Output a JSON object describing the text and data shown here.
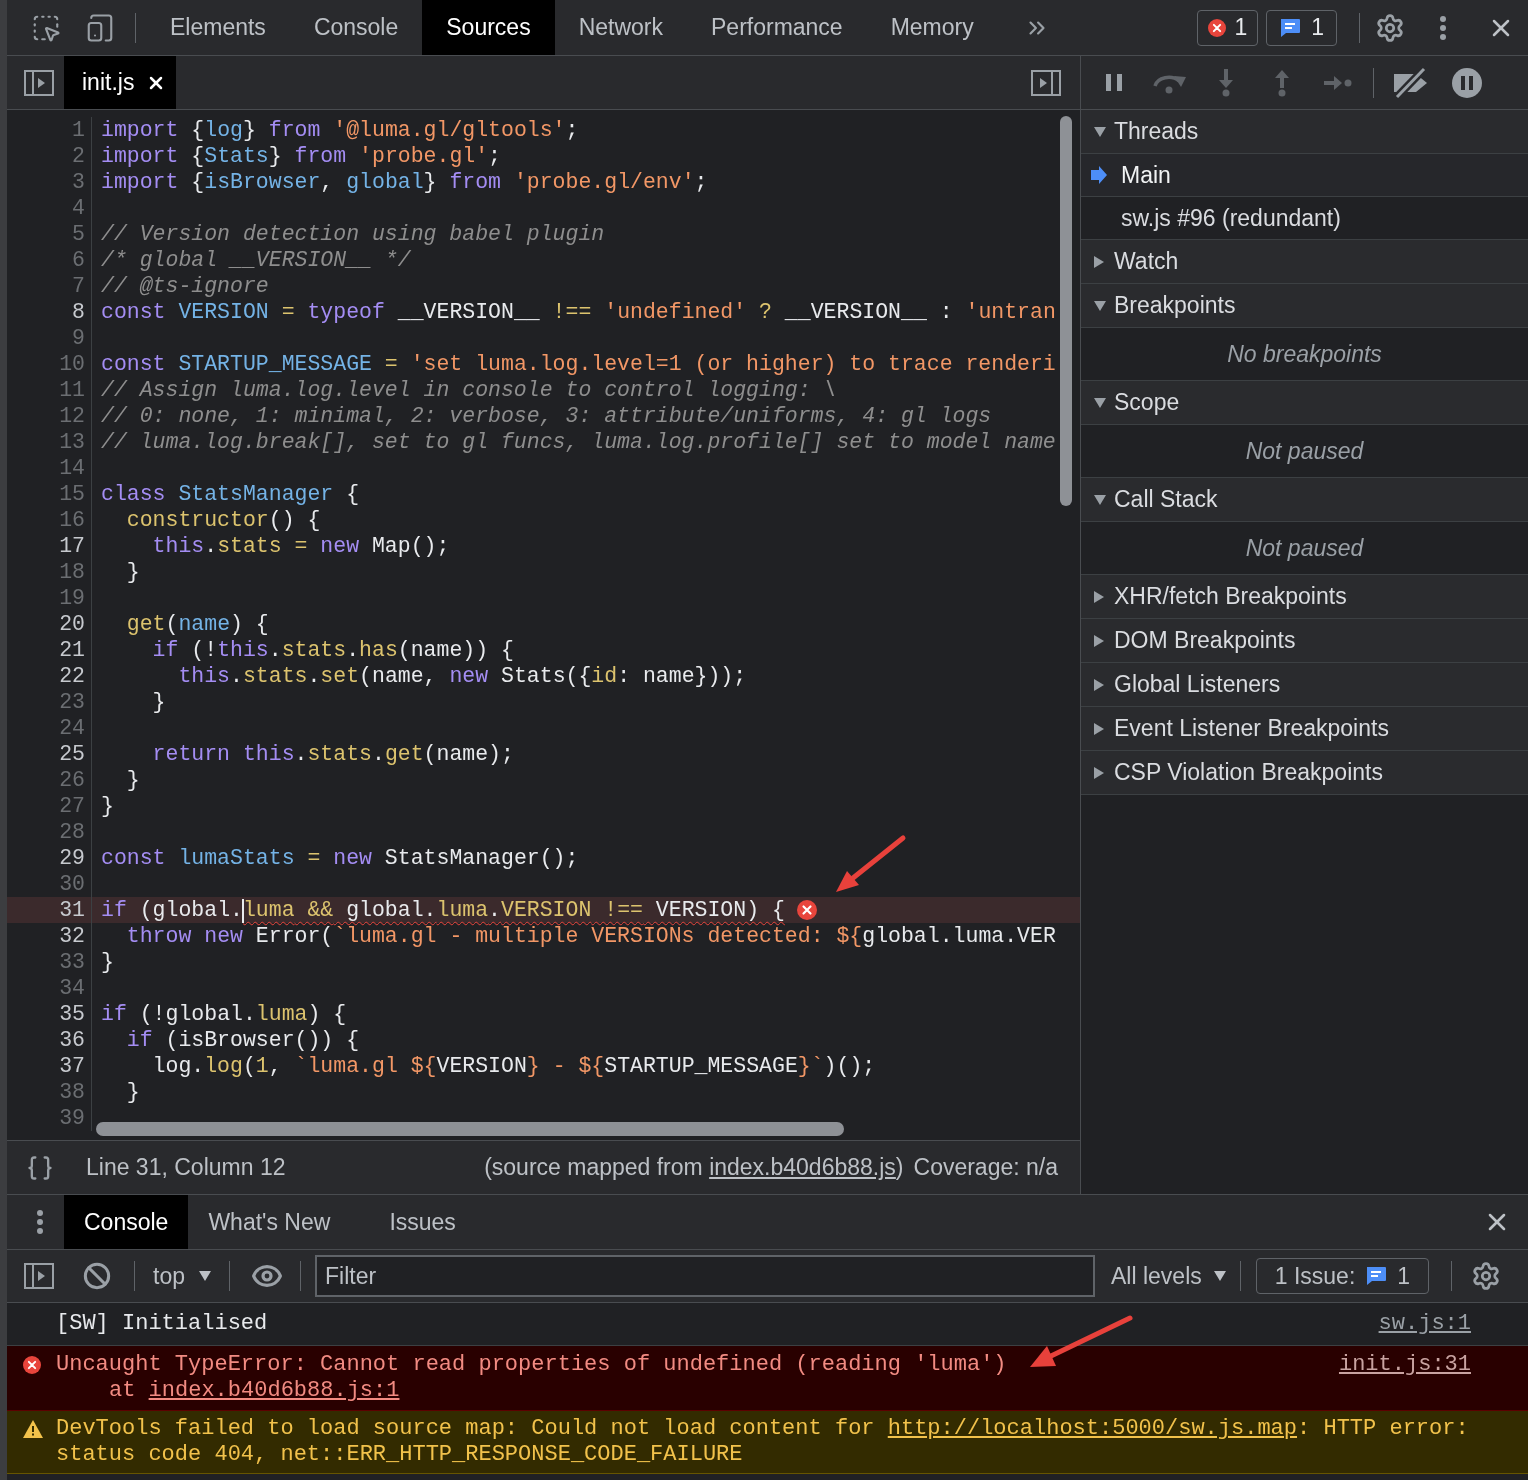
{
  "devtools_tabs": [
    {
      "label": "Elements",
      "selected": false
    },
    {
      "label": "Console",
      "selected": false
    },
    {
      "label": "Sources",
      "selected": true
    },
    {
      "label": "Network",
      "selected": false
    },
    {
      "label": "Performance",
      "selected": false
    },
    {
      "label": "Memory",
      "selected": false
    }
  ],
  "counters": {
    "errors": "1",
    "messages": "1"
  },
  "editor": {
    "open_files": [
      {
        "name": "init.js",
        "selected": true
      }
    ],
    "lines": [
      {
        "number": "1",
        "mapped": false,
        "error": false,
        "tokens": [
          {
            "kind": "keyword",
            "text": "import"
          },
          {
            "kind": "plain",
            "text": " {"
          },
          {
            "kind": "def",
            "text": "log"
          },
          {
            "kind": "plain",
            "text": "} "
          },
          {
            "kind": "keyword",
            "text": "from"
          },
          {
            "kind": "string",
            "text": " '@luma.gl/gltools'"
          },
          {
            "kind": "plain",
            "text": ";"
          }
        ]
      },
      {
        "number": "2",
        "mapped": false,
        "error": false,
        "tokens": [
          {
            "kind": "keyword",
            "text": "import"
          },
          {
            "kind": "plain",
            "text": " {"
          },
          {
            "kind": "def",
            "text": "Stats"
          },
          {
            "kind": "plain",
            "text": "} "
          },
          {
            "kind": "keyword",
            "text": "from"
          },
          {
            "kind": "string",
            "text": " 'probe.gl'"
          },
          {
            "kind": "plain",
            "text": ";"
          }
        ]
      },
      {
        "number": "3",
        "mapped": false,
        "error": false,
        "tokens": [
          {
            "kind": "keyword",
            "text": "import"
          },
          {
            "kind": "plain",
            "text": " {"
          },
          {
            "kind": "def",
            "text": "isBrowser"
          },
          {
            "kind": "plain",
            "text": ", "
          },
          {
            "kind": "def",
            "text": "global"
          },
          {
            "kind": "plain",
            "text": "} "
          },
          {
            "kind": "keyword",
            "text": "from"
          },
          {
            "kind": "string",
            "text": " 'probe.gl/env'"
          },
          {
            "kind": "plain",
            "text": ";"
          }
        ]
      },
      {
        "number": "4",
        "mapped": false,
        "error": false
      },
      {
        "number": "5",
        "mapped": false,
        "error": false,
        "tokens": [
          {
            "kind": "comment",
            "text": "// Version detection using babel plugin"
          }
        ]
      },
      {
        "number": "6",
        "mapped": false,
        "error": false,
        "tokens": [
          {
            "kind": "comment",
            "text": "/* global __VERSION__ */"
          }
        ]
      },
      {
        "number": "7",
        "mapped": false,
        "error": false,
        "tokens": [
          {
            "kind": "comment",
            "text": "// @ts-ignore"
          }
        ]
      },
      {
        "number": "8",
        "mapped": true,
        "error": false,
        "tokens": [
          {
            "kind": "keyword",
            "text": "const"
          },
          {
            "kind": "def",
            "text": " VERSION"
          },
          {
            "kind": "operator",
            "text": " ="
          },
          {
            "kind": "keyword",
            "text": " typeof"
          },
          {
            "kind": "plain",
            "text": " __VERSION__ "
          },
          {
            "kind": "operator",
            "text": "!=="
          },
          {
            "kind": "string",
            "text": " 'undefined'"
          },
          {
            "kind": "operator",
            "text": " ?"
          },
          {
            "kind": "plain",
            "text": " __VERSION__ : "
          },
          {
            "kind": "string",
            "text": "'untran"
          }
        ]
      },
      {
        "number": "9",
        "mapped": false,
        "error": false
      },
      {
        "number": "10",
        "mapped": false,
        "error": false,
        "tokens": [
          {
            "kind": "keyword",
            "text": "const"
          },
          {
            "kind": "def",
            "text": " STARTUP_MESSAGE"
          },
          {
            "kind": "operator",
            "text": " ="
          },
          {
            "kind": "string",
            "text": " 'set luma.log.level=1 (or higher) to trace renderi"
          }
        ]
      },
      {
        "number": "11",
        "mapped": false,
        "error": false,
        "tokens": [
          {
            "kind": "comment",
            "text": "// Assign luma.log.level in console to control logging: \\"
          }
        ]
      },
      {
        "number": "12",
        "mapped": false,
        "error": false,
        "tokens": [
          {
            "kind": "comment",
            "text": "// 0: none, 1: minimal, 2: verbose, 3: attribute/uniforms, 4: gl logs"
          }
        ]
      },
      {
        "number": "13",
        "mapped": false,
        "error": false,
        "tokens": [
          {
            "kind": "comment",
            "text": "// luma.log.break[], set to gl funcs, luma.log.profile[] set to model name"
          }
        ]
      },
      {
        "number": "14",
        "mapped": false,
        "error": false
      },
      {
        "number": "15",
        "mapped": false,
        "error": false,
        "tokens": [
          {
            "kind": "keyword",
            "text": "class"
          },
          {
            "kind": "def",
            "text": " StatsManager"
          },
          {
            "kind": "plain",
            "text": " {"
          }
        ]
      },
      {
        "number": "16",
        "mapped": false,
        "error": false,
        "tokens": [
          {
            "kind": "property",
            "text": "  constructor"
          },
          {
            "kind": "plain",
            "text": "() {"
          }
        ]
      },
      {
        "number": "17",
        "mapped": true,
        "error": false,
        "tokens": [
          {
            "kind": "keyword",
            "text": "    this"
          },
          {
            "kind": "plain",
            "text": "."
          },
          {
            "kind": "property",
            "text": "stats"
          },
          {
            "kind": "operator",
            "text": " ="
          },
          {
            "kind": "keyword",
            "text": " new"
          },
          {
            "kind": "plain",
            "text": " Map();"
          }
        ]
      },
      {
        "number": "18",
        "mapped": false,
        "error": false,
        "tokens": [
          {
            "kind": "plain",
            "text": "  }"
          }
        ]
      },
      {
        "number": "19",
        "mapped": false,
        "error": false
      },
      {
        "number": "20",
        "mapped": true,
        "error": false,
        "tokens": [
          {
            "kind": "property",
            "text": "  get"
          },
          {
            "kind": "plain",
            "text": "("
          },
          {
            "kind": "def",
            "text": "name"
          },
          {
            "kind": "plain",
            "text": ") {"
          }
        ]
      },
      {
        "number": "21",
        "mapped": true,
        "error": false,
        "tokens": [
          {
            "kind": "keyword",
            "text": "    if"
          },
          {
            "kind": "plain",
            "text": " (!"
          },
          {
            "kind": "keyword",
            "text": "this"
          },
          {
            "kind": "plain",
            "text": "."
          },
          {
            "kind": "property",
            "text": "stats"
          },
          {
            "kind": "plain",
            "text": "."
          },
          {
            "kind": "property",
            "text": "has"
          },
          {
            "kind": "plain",
            "text": "(name)) {"
          }
        ]
      },
      {
        "number": "22",
        "mapped": true,
        "error": false,
        "tokens": [
          {
            "kind": "keyword",
            "text": "      this"
          },
          {
            "kind": "plain",
            "text": "."
          },
          {
            "kind": "property",
            "text": "stats"
          },
          {
            "kind": "plain",
            "text": "."
          },
          {
            "kind": "property",
            "text": "set"
          },
          {
            "kind": "plain",
            "text": "(name, "
          },
          {
            "kind": "keyword",
            "text": "new"
          },
          {
            "kind": "plain",
            "text": " Stats({"
          },
          {
            "kind": "property",
            "text": "id"
          },
          {
            "kind": "plain",
            "text": ": name}));"
          }
        ]
      },
      {
        "number": "23",
        "mapped": false,
        "error": false,
        "tokens": [
          {
            "kind": "plain",
            "text": "    }"
          }
        ]
      },
      {
        "number": "24",
        "mapped": false,
        "error": false
      },
      {
        "number": "25",
        "mapped": true,
        "error": false,
        "tokens": [
          {
            "kind": "keyword",
            "text": "    return"
          },
          {
            "kind": "keyword",
            "text": " this"
          },
          {
            "kind": "plain",
            "text": "."
          },
          {
            "kind": "property",
            "text": "stats"
          },
          {
            "kind": "plain",
            "text": "."
          },
          {
            "kind": "property",
            "text": "get"
          },
          {
            "kind": "plain",
            "text": "(name);"
          }
        ]
      },
      {
        "number": "26",
        "mapped": false,
        "error": false,
        "tokens": [
          {
            "kind": "plain",
            "text": "  }"
          }
        ]
      },
      {
        "number": "27",
        "mapped": false,
        "error": false,
        "tokens": [
          {
            "kind": "plain",
            "text": "}"
          }
        ]
      },
      {
        "number": "28",
        "mapped": false,
        "error": false
      },
      {
        "number": "29",
        "mapped": true,
        "error": false,
        "tokens": [
          {
            "kind": "keyword",
            "text": "const"
          },
          {
            "kind": "def",
            "text": " lumaStats"
          },
          {
            "kind": "operator",
            "text": " ="
          },
          {
            "kind": "keyword",
            "text": " new"
          },
          {
            "kind": "plain",
            "text": " StatsManager();"
          }
        ]
      },
      {
        "number": "30",
        "mapped": false,
        "error": false
      },
      {
        "number": "31",
        "mapped": true,
        "error": true,
        "tokens": [
          {
            "kind": "keyword",
            "text": "if",
            "squiggle": false,
            "caret": false
          },
          {
            "kind": "plain",
            "text": " (global.",
            "squiggle": false,
            "caret": false
          },
          {
            "kind": "property",
            "text": "luma",
            "squiggle": true,
            "caret": true
          },
          {
            "kind": "operator",
            "text": " &&",
            "squiggle": true,
            "caret": false
          },
          {
            "kind": "plain",
            "text": " global.",
            "squiggle": true,
            "caret": false
          },
          {
            "kind": "property",
            "text": "luma",
            "squiggle": true,
            "caret": false
          },
          {
            "kind": "plain",
            "text": ".",
            "squiggle": true,
            "caret": false
          },
          {
            "kind": "property",
            "text": "VERSION",
            "squiggle": true,
            "caret": false
          },
          {
            "kind": "operator",
            "text": " !==",
            "squiggle": true,
            "caret": false
          },
          {
            "kind": "plain",
            "text": " VERSION) {",
            "squiggle": true,
            "caret": false
          }
        ]
      },
      {
        "number": "32",
        "mapped": true,
        "error": false,
        "tokens": [
          {
            "kind": "keyword",
            "text": "  throw"
          },
          {
            "kind": "keyword",
            "text": " new"
          },
          {
            "kind": "plain",
            "text": " Error("
          },
          {
            "kind": "string",
            "text": "`luma.gl - multiple VERSIONs detected: ${"
          },
          {
            "kind": "plain",
            "text": "global.luma.VER"
          }
        ]
      },
      {
        "number": "33",
        "mapped": false,
        "error": false,
        "tokens": [
          {
            "kind": "plain",
            "text": "}"
          }
        ]
      },
      {
        "number": "34",
        "mapped": false,
        "error": false
      },
      {
        "number": "35",
        "mapped": true,
        "error": false,
        "tokens": [
          {
            "kind": "keyword",
            "text": "if"
          },
          {
            "kind": "plain",
            "text": " (!global."
          },
          {
            "kind": "property",
            "text": "luma"
          },
          {
            "kind": "plain",
            "text": ") {"
          }
        ]
      },
      {
        "number": "36",
        "mapped": true,
        "error": false,
        "tokens": [
          {
            "kind": "keyword",
            "text": "  if"
          },
          {
            "kind": "plain",
            "text": " (isBrowser()) {"
          }
        ]
      },
      {
        "number": "37",
        "mapped": true,
        "error": false,
        "tokens": [
          {
            "kind": "plain",
            "text": "    log."
          },
          {
            "kind": "property",
            "text": "log"
          },
          {
            "kind": "plain",
            "text": "("
          },
          {
            "kind": "number",
            "text": "1"
          },
          {
            "kind": "plain",
            "text": ", "
          },
          {
            "kind": "string",
            "text": "`luma.gl ${"
          },
          {
            "kind": "plain",
            "text": "VERSION"
          },
          {
            "kind": "string",
            "text": "} - ${"
          },
          {
            "kind": "plain",
            "text": "STARTUP_MESSAGE"
          },
          {
            "kind": "string",
            "text": "}`"
          },
          {
            "kind": "plain",
            "text": ")();"
          }
        ]
      },
      {
        "number": "38",
        "mapped": false,
        "error": false,
        "tokens": [
          {
            "kind": "plain",
            "text": "  }"
          }
        ]
      },
      {
        "number": "39",
        "mapped": false,
        "error": false
      }
    ],
    "status_bar": {
      "position": "Line 31, Column 12",
      "source_map": {
        "before": "(source mapped from ",
        "link": "index.b40d6b88.js",
        "after": ")"
      },
      "coverage": "Coverage: n/a"
    }
  },
  "debugger_toolbar": [
    {
      "kind": "pause",
      "disabled": false
    },
    {
      "kind": "step_over",
      "disabled": true
    },
    {
      "kind": "step_into",
      "disabled": true
    },
    {
      "kind": "step_out",
      "disabled": true
    },
    {
      "kind": "step",
      "disabled": true
    },
    {
      "kind": "deactivate_breakpoints",
      "disabled": false
    },
    {
      "kind": "pause_on_exceptions",
      "disabled": false
    }
  ],
  "sidebar": {
    "sections": [
      {
        "title": "Threads",
        "expanded": true,
        "threads": [
          {
            "name": "Main",
            "selected": true
          },
          {
            "name": "sw.js #96 (redundant)",
            "selected": false
          }
        ]
      },
      {
        "title": "Watch",
        "expanded": false
      },
      {
        "title": "Breakpoints",
        "expanded": true,
        "note": "No breakpoints"
      },
      {
        "title": "Scope",
        "expanded": true,
        "note": "Not paused"
      },
      {
        "title": "Call Stack",
        "expanded": true,
        "note": "Not paused"
      },
      {
        "title": "XHR/fetch Breakpoints",
        "expanded": false
      },
      {
        "title": "DOM Breakpoints",
        "expanded": false
      },
      {
        "title": "Global Listeners",
        "expanded": false
      },
      {
        "title": "Event Listener Breakpoints",
        "expanded": false
      },
      {
        "title": "CSP Violation Breakpoints",
        "expanded": false
      }
    ]
  },
  "drawer": {
    "tabs": [
      {
        "label": "Console",
        "selected": true
      },
      {
        "label": "What's New",
        "selected": false
      },
      {
        "label": "Issues",
        "selected": false
      }
    ],
    "console_toolbar": {
      "context": "top",
      "filter_placeholder": "Filter",
      "levels": "All levels",
      "issues_label": "1 Issue:",
      "issues_count": "1"
    },
    "messages": [
      {
        "kind": "log",
        "parts": [
          {
            "kind": "text",
            "text": "[SW] Initialised"
          }
        ],
        "source": "sw.js:1"
      },
      {
        "kind": "error",
        "parts": [
          {
            "kind": "text",
            "text": "Uncaught TypeError: Cannot read properties of undefined (reading 'luma')"
          }
        ],
        "stack": [
          {
            "text": "at",
            "link": "index.b40d6b88.js:1"
          }
        ],
        "source": "init.js:31"
      },
      {
        "kind": "warning",
        "parts": [
          {
            "kind": "text",
            "text": "DevTools failed to load source map: Could not load content for "
          },
          {
            "kind": "link",
            "text": "http://localhost:5000/sw.js.map"
          },
          {
            "kind": "text",
            "text": ": HTTP error: status code 404, net::ERR_HTTP_RESPONSE_CODE_FAILURE"
          }
        ]
      }
    ]
  }
}
